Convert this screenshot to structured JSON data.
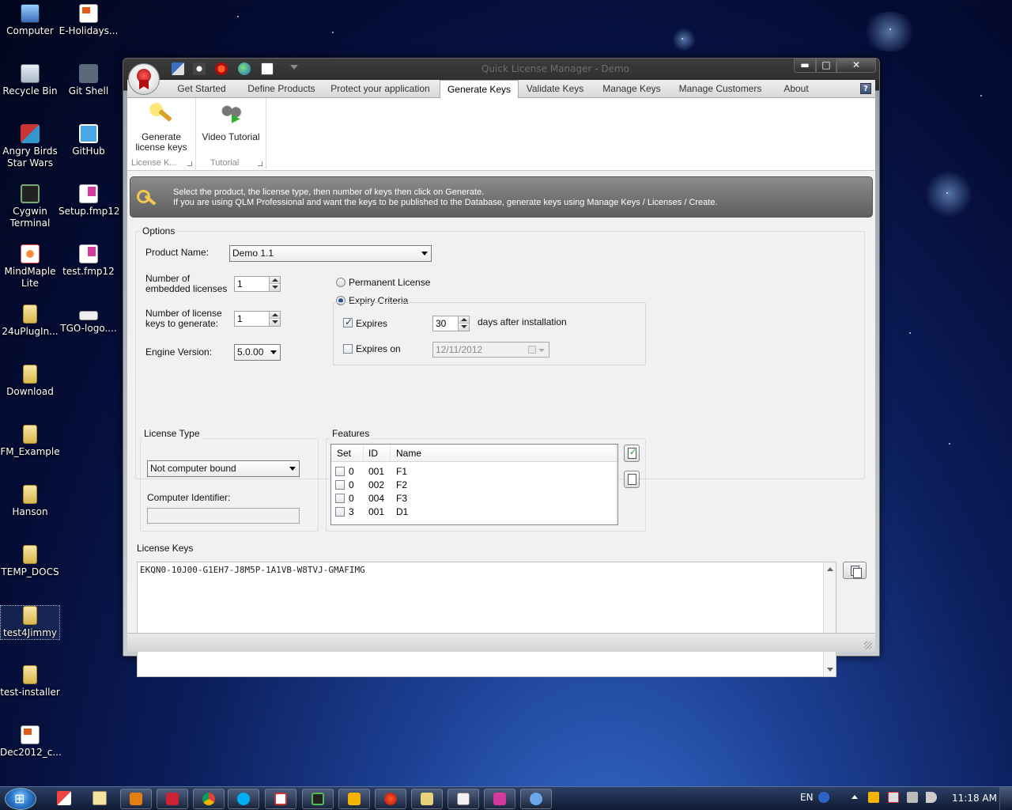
{
  "desktop": {
    "icons": [
      {
        "label": "Computer",
        "icon": "computer-icon"
      },
      {
        "label": "E-Holidays...",
        "icon": "pdf-icon"
      },
      {
        "label": "Recycle Bin",
        "icon": "recycle-bin-icon"
      },
      {
        "label": "Git Shell",
        "icon": "git-shell-icon"
      },
      {
        "label": "Angry Birds Star Wars",
        "icon": "angry-birds-icon"
      },
      {
        "label": "GitHub",
        "icon": "github-icon"
      },
      {
        "label": "Cygwin Terminal",
        "icon": "terminal-icon"
      },
      {
        "label": "Setup.fmp12",
        "icon": "filemaker-icon"
      },
      {
        "label": "MindMaple Lite",
        "icon": "mindmaple-icon"
      },
      {
        "label": "test.fmp12",
        "icon": "filemaker-icon"
      },
      {
        "label": "24uPlugIn...",
        "icon": "folder-icon"
      },
      {
        "label": "TGO-logo....",
        "icon": "image-file-icon"
      },
      {
        "label": "Download",
        "icon": "folder-icon"
      },
      {
        "label": "FM_Example",
        "icon": "folder-icon"
      },
      {
        "label": "Hanson",
        "icon": "folder-icon"
      },
      {
        "label": "TEMP_DOCS",
        "icon": "folder-icon"
      },
      {
        "label": "test4Jimmy",
        "icon": "folder-icon"
      },
      {
        "label": "test-installer",
        "icon": "folder-icon"
      },
      {
        "label": "Dec2012_c...",
        "icon": "pdf-icon"
      }
    ]
  },
  "window": {
    "title": "Quick License Manager - Demo",
    "caption": {
      "minimize": "▬",
      "maximize": "□",
      "close": "✕"
    },
    "tabs": [
      {
        "label": "Get Started"
      },
      {
        "label": "Define Products"
      },
      {
        "label": "Protect your application"
      },
      {
        "label": "Generate Keys",
        "active": true
      },
      {
        "label": "Validate Keys"
      },
      {
        "label": "Manage Keys"
      },
      {
        "label": "Manage Customers"
      },
      {
        "label": "About"
      }
    ],
    "help": "?",
    "ribbon": {
      "groups": [
        {
          "button": "Generate license keys",
          "button_line1": "Generate",
          "button_line2": "license keys",
          "group_label": "License K..."
        },
        {
          "button": "Video Tutorial",
          "group_label": "Tutorial"
        }
      ]
    }
  },
  "info": {
    "line1": "Select the product, the license type, then number of keys then click on Generate.",
    "line2": "If you are using QLM Professional and want the keys to be published to the Database, generate keys using Manage Keys / Licenses / Create."
  },
  "options": {
    "group_label": "Options",
    "product_name_label": "Product Name:",
    "product_name_value": "Demo 1.1",
    "embedded_label_line1": "Number of",
    "embedded_label_line2": "embedded licenses",
    "embedded_value": "1",
    "keys_label_line1": "Number of license",
    "keys_label_line2": "keys to generate:",
    "keys_value": "1",
    "engine_label": "Engine Version:",
    "engine_value": "5.0.00",
    "permanent_label": "Permanent License",
    "permanent_selected": false,
    "expiry_label": "Expiry Criteria",
    "expiry_selected": true,
    "expires_label": "Expires",
    "expires_checked": true,
    "expires_days": "30",
    "days_suffix": "days after installation",
    "expires_on_label": "Expires on",
    "expires_on_checked": false,
    "expires_on_date": "12/11/2012"
  },
  "license_type": {
    "group_label": "License Type",
    "value": "Not computer bound",
    "computer_identifier_label": "Computer Identifier:",
    "computer_identifier_value": ""
  },
  "features": {
    "group_label": "Features",
    "columns": [
      "Set",
      "ID",
      "Name"
    ],
    "rows": [
      {
        "set": "0",
        "id": "001",
        "name": "F1",
        "checked": false
      },
      {
        "set": "0",
        "id": "002",
        "name": "F2",
        "checked": false
      },
      {
        "set": "0",
        "id": "004",
        "name": "F3",
        "checked": false
      },
      {
        "set": "3",
        "id": "001",
        "name": "D1",
        "checked": false
      }
    ]
  },
  "license_keys": {
    "group_label": "License Keys",
    "value": "EKQN0-10J00-G1EH7-J8M5P-1A1VB-W8TVJ-GMAFIMG"
  },
  "taskbar": {
    "language": "EN",
    "clock": "11:18 AM"
  }
}
